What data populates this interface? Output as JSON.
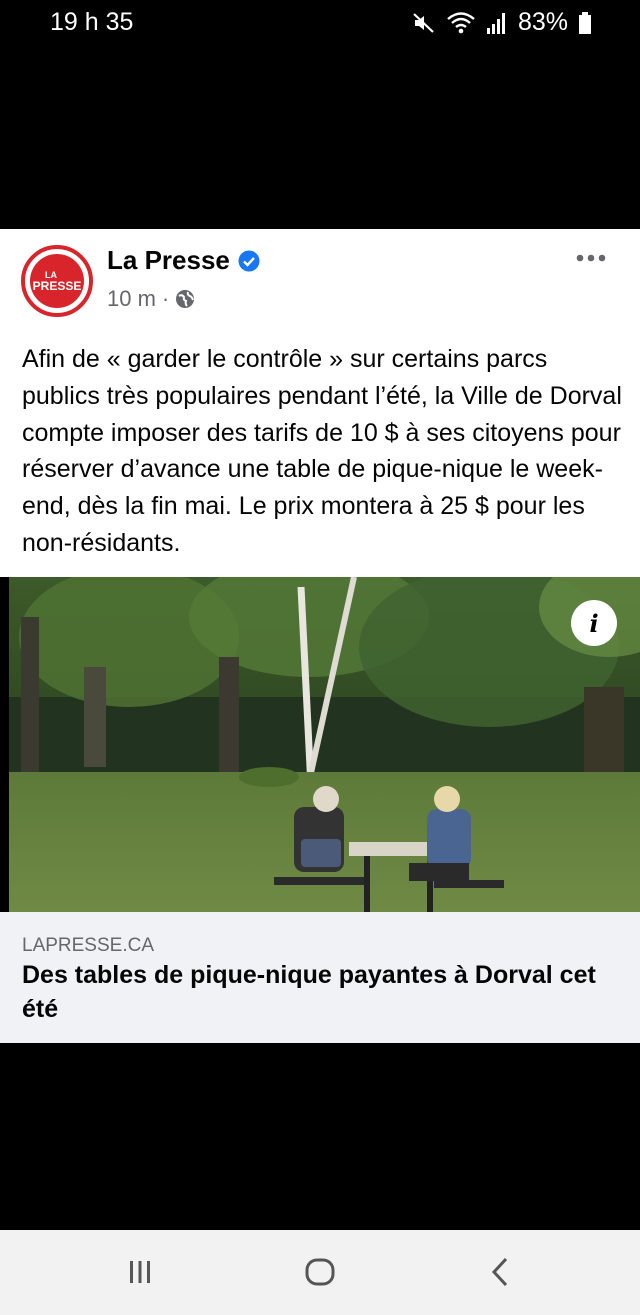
{
  "status": {
    "time": "19 h 35",
    "battery": "83%"
  },
  "post": {
    "page_name": "La Presse",
    "avatar_line1": "LA",
    "avatar_line2": "PRESSE",
    "time_ago": "10 m",
    "separator": "·",
    "text": "Afin de « garder le contrôle » sur certains parcs publics très populaires pendant l’été, la Ville de Dorval compte imposer des tarifs de 10 $ à ses citoyens pour réserver d’avance une table de pique-nique le week-end, dès la fin mai. Le prix montera à 25 $ pour les non-résidants.",
    "info_glyph": "i"
  },
  "link": {
    "domain": "LAPRESSE.CA",
    "title": "Des tables de pique-nique payantes à Dorval cet été"
  },
  "icons": [
    "mute-icon",
    "wifi-icon",
    "signal-icon",
    "battery-icon",
    "verified-badge-icon",
    "globe-icon",
    "more-options-icon",
    "info-icon",
    "recent-apps-icon",
    "home-icon",
    "back-icon"
  ],
  "colors": {
    "brand_red": "#d8252c",
    "verified_blue": "#1877f2",
    "link_card_bg": "#f0f2f5"
  }
}
